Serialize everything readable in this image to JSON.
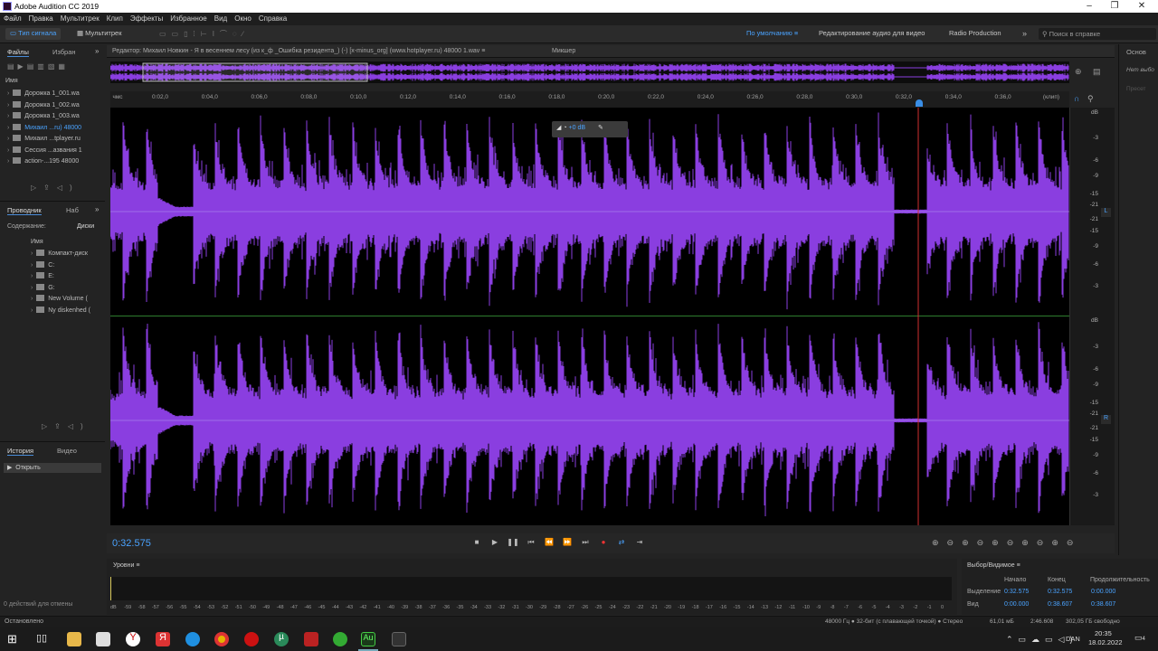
{
  "window": {
    "title": "Adobe Audition CC 2019",
    "controls": [
      "–",
      "❐",
      "✕"
    ]
  },
  "menu": [
    "Файл",
    "Правка",
    "Мультитрек",
    "Клип",
    "Эффекты",
    "Избранное",
    "Вид",
    "Окно",
    "Справка"
  ],
  "toolbar": {
    "mode_waveform": "Тип сигнала",
    "mode_multitrack": "Мультитрек",
    "workspace_default": "По умолчанию",
    "workspace_video": "Редактирование аудио для видео",
    "workspace_radio": "Radio Production",
    "search_placeholder": "Поиск в справке"
  },
  "files_panel": {
    "tab_files": "Файлы",
    "tab_favorites": "Избран",
    "column_name": "Имя",
    "items": [
      {
        "label": "Дорожка 1_001.wa",
        "selected": false
      },
      {
        "label": "Дорожка 1_002.wa",
        "selected": false
      },
      {
        "label": "Дорожка 1_003.wa",
        "selected": false
      },
      {
        "label": "Михаил ...ru) 48000",
        "selected": true
      },
      {
        "label": "Михаил ...tplayer.ru",
        "selected": false
      },
      {
        "label": "Сессия ...азвания 1",
        "selected": false
      },
      {
        "label": "action-...195 48000",
        "selected": false
      }
    ]
  },
  "explorer_panel": {
    "tab_explorer": "Проводник",
    "tab_sets": "Наб",
    "sub_content": "Содержание:",
    "sub_disks": "Диски",
    "column_name": "Имя",
    "items": [
      "Компакт-диск",
      "C:",
      "E:",
      "G:",
      "New Volume (",
      "Ny diskenhed ("
    ]
  },
  "history_panel": {
    "tab_history": "История",
    "tab_video": "Видео",
    "item": "Открыть",
    "undo_status": "0 действий для отмены"
  },
  "editor": {
    "tab_editor": "Редактор: Михаил Новкин - Я в весеннем лесу (из к_ф _Ошибка резидента_) (-) [x-minus_org] (www.hotplayer.ru) 48000 1.wav",
    "tab_mixer": "Микшер",
    "hud_gain": "+0 dB",
    "ruler_unit": "чмс",
    "ruler_end": "(клип)",
    "ticks": [
      "0:02,0",
      "0:04,0",
      "0:06,0",
      "0:08,0",
      "0:10,0",
      "0:12,0",
      "0:14,0",
      "0:16,0",
      "0:18,0",
      "0:20,0",
      "0:22,0",
      "0:24,0",
      "0:26,0",
      "0:28,0",
      "0:30,0",
      "0:32,0",
      "0:34,0",
      "0:36,0"
    ],
    "db_label": "dB",
    "db_scale": [
      "-3",
      "-6",
      "-9",
      "-15",
      "-21",
      "-21",
      "-15",
      "-9",
      "-6",
      "-3"
    ],
    "channel_left": "L",
    "channel_right": "R",
    "waveform_color": "#8a3ee0",
    "playhead_color": "#d13030"
  },
  "transport": {
    "time": "0:32.575"
  },
  "levels": {
    "title": "Уровни",
    "scale": [
      "dB",
      "-59",
      "-58",
      "-57",
      "-56",
      "-55",
      "-54",
      "-53",
      "-52",
      "-51",
      "-50",
      "-49",
      "-48",
      "-47",
      "-46",
      "-45",
      "-44",
      "-43",
      "-42",
      "-41",
      "-40",
      "-39",
      "-38",
      "-37",
      "-36",
      "-35",
      "-34",
      "-33",
      "-32",
      "-31",
      "-30",
      "-29",
      "-28",
      "-27",
      "-26",
      "-25",
      "-24",
      "-23",
      "-22",
      "-21",
      "-20",
      "-19",
      "-18",
      "-17",
      "-16",
      "-15",
      "-14",
      "-13",
      "-12",
      "-11",
      "-10",
      "-9",
      "-8",
      "-7",
      "-6",
      "-5",
      "-4",
      "-3",
      "-2",
      "-1",
      "0"
    ]
  },
  "selection_panel": {
    "title": "Выбор/Видимое",
    "col_start": "Начало",
    "col_end": "Конец",
    "col_duration": "Продолжительность",
    "row_selection": "Выделение",
    "row_view": "Вид",
    "sel_start": "0:32.575",
    "sel_end": "0:32.575",
    "sel_duration": "0:00.000",
    "view_start": "0:00.000",
    "view_end": "0:38.607",
    "view_duration": "0:38.607"
  },
  "right_panel": {
    "tab": "Основ",
    "text1": "Нет выбо",
    "text2": "Пресет"
  },
  "status": {
    "left": "Остановлено",
    "format": "48000 Гц ● 32-бит (с плавающей точкой) ● Стерео",
    "size": "61,01 мБ",
    "duration": "2:46.608",
    "free": "302,05 ГБ свободно"
  },
  "taskbar": {
    "lang": "DAN",
    "time": "20:35",
    "date": "18.02.2022",
    "notif": "4"
  }
}
